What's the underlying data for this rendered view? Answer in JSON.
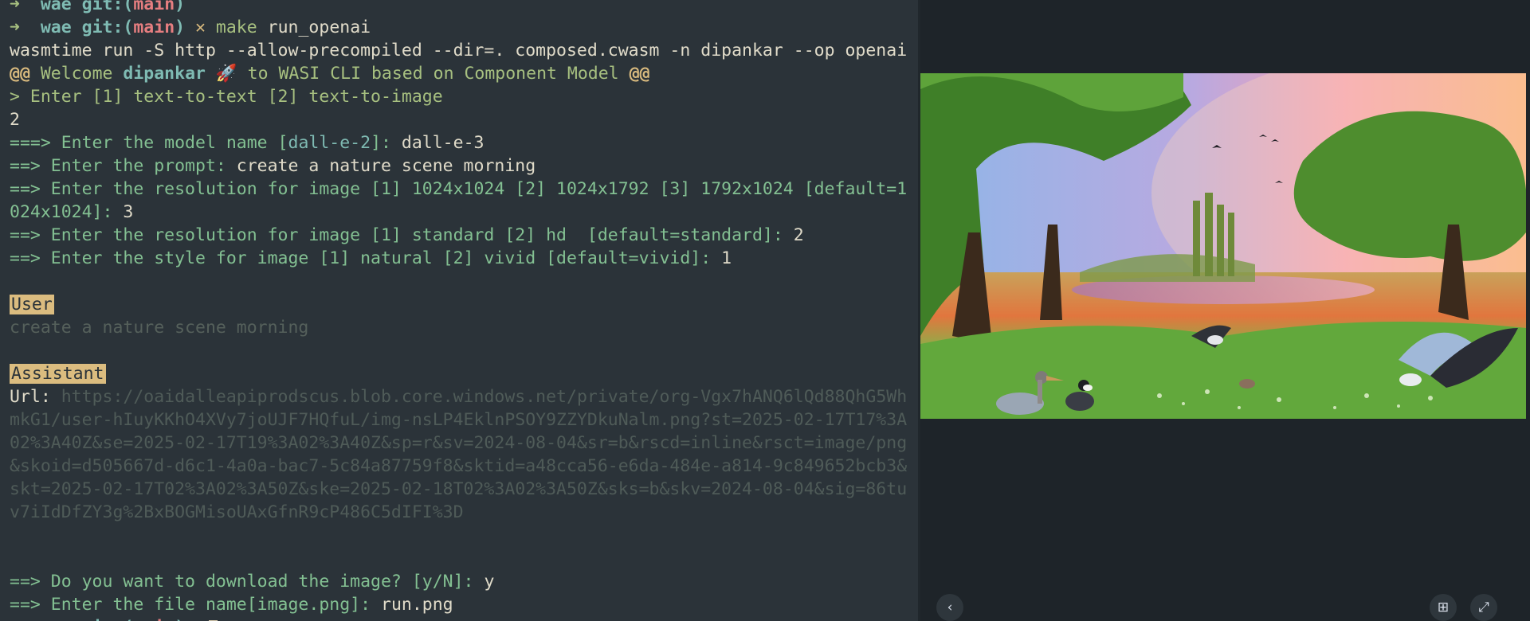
{
  "terminal": {
    "lines": [
      {
        "parts": [
          {
            "t": "➜  ",
            "c": "green bold"
          },
          {
            "t": "wae ",
            "c": "aqua bold"
          },
          {
            "t": "git:(",
            "c": "aqua bold"
          },
          {
            "t": "main",
            "c": "red bold"
          },
          {
            "t": ")",
            "c": "aqua bold"
          }
        ]
      },
      {
        "parts": [
          {
            "t": "➜  ",
            "c": "green bold"
          },
          {
            "t": "wae ",
            "c": "aqua bold"
          },
          {
            "t": "git:(",
            "c": "aqua bold"
          },
          {
            "t": "main",
            "c": "red bold"
          },
          {
            "t": ") ",
            "c": "aqua bold"
          },
          {
            "t": "✕ ",
            "c": "yellow bold"
          },
          {
            "t": "make ",
            "c": "green"
          },
          {
            "t": "run_openai",
            "c": "white"
          }
        ]
      },
      {
        "parts": [
          {
            "t": "wasmtime run -S http --allow-precompiled --dir=. composed.cwasm -n dipankar --op openai",
            "c": "white"
          }
        ]
      },
      {
        "parts": [
          {
            "t": "@@ ",
            "c": "yellow bold"
          },
          {
            "t": "Welcome ",
            "c": "green"
          },
          {
            "t": "dipankar",
            "c": "aqua bold"
          },
          {
            "t": " 🚀 ",
            "c": "white"
          },
          {
            "t": "to WASI CLI based on Component Model ",
            "c": "green"
          },
          {
            "t": "@@",
            "c": "yellow bold"
          }
        ]
      },
      {
        "parts": [
          {
            "t": "> Enter [1] text-to-text [2] text-to-image",
            "c": "green"
          }
        ]
      },
      {
        "parts": [
          {
            "t": "2",
            "c": "white"
          }
        ]
      },
      {
        "parts": [
          {
            "t": "===> Enter the model name [",
            "c": "cyan"
          },
          {
            "t": "dall-e-2",
            "c": "aqua"
          },
          {
            "t": "]: ",
            "c": "cyan"
          },
          {
            "t": "dall-e-3",
            "c": "white"
          }
        ]
      },
      {
        "parts": [
          {
            "t": "==> Enter the prompt: ",
            "c": "cyan"
          },
          {
            "t": "create a nature scene morning",
            "c": "white"
          }
        ]
      },
      {
        "parts": [
          {
            "t": "==> Enter the resolution for image [1] 1024x1024 [2] 1024x1792 [3] 1792x1024 [default=1",
            "c": "cyan"
          }
        ]
      },
      {
        "parts": [
          {
            "t": "024x1024]: ",
            "c": "cyan"
          },
          {
            "t": "3",
            "c": "white"
          }
        ]
      },
      {
        "parts": [
          {
            "t": "==> Enter the resolution for image [1] standard [2] hd  [default=standard]: ",
            "c": "cyan"
          },
          {
            "t": "2",
            "c": "white"
          }
        ]
      },
      {
        "parts": [
          {
            "t": "==> Enter the style for image [1] natural [2] vivid [default=vivid]: ",
            "c": "cyan"
          },
          {
            "t": "1",
            "c": "white"
          }
        ]
      },
      {
        "parts": []
      },
      {
        "parts": [
          {
            "t": "User",
            "c": "chip"
          }
        ]
      },
      {
        "parts": [
          {
            "t": "create a nature scene morning",
            "c": "dimmer"
          }
        ]
      },
      {
        "parts": []
      },
      {
        "parts": [
          {
            "t": "Assistant",
            "c": "chip"
          }
        ]
      },
      {
        "parts": [
          {
            "t": "Url: ",
            "c": "white"
          },
          {
            "t": "https://oaidalleapiprodscus.blob.core.windows.net/private/org-Vgx7hANQ6lQd88QhG5Wh",
            "c": "dim"
          }
        ]
      },
      {
        "parts": [
          {
            "t": "mkG1/user-hIuyKKhO4XVy7joUJF7HQfuL/img-nsLP4EklnPSOY9ZZYDkuNalm.png?st=2025-02-17T17%3A",
            "c": "dim"
          }
        ]
      },
      {
        "parts": [
          {
            "t": "02%3A40Z&se=2025-02-17T19%3A02%3A40Z&sp=r&sv=2024-08-04&sr=b&rscd=inline&rsct=image/png",
            "c": "dim"
          }
        ]
      },
      {
        "parts": [
          {
            "t": "&skoid=d505667d-d6c1-4a0a-bac7-5c84a87759f8&sktid=a48cca56-e6da-484e-a814-9c849652bcb3&",
            "c": "dim"
          }
        ]
      },
      {
        "parts": [
          {
            "t": "skt=2025-02-17T02%3A02%3A50Z&ske=2025-02-18T02%3A02%3A50Z&sks=b&skv=2024-08-04&sig=86tu",
            "c": "dim"
          }
        ]
      },
      {
        "parts": [
          {
            "t": "v7iIdDfZY3g%2BxBOGMisoUAxGfnR9cP486C5dIFI%3D",
            "c": "dim"
          }
        ]
      },
      {
        "parts": []
      },
      {
        "parts": []
      },
      {
        "parts": [
          {
            "t": "==> Do you want to download the image? [y/N]: ",
            "c": "cyan"
          },
          {
            "t": "y",
            "c": "white"
          }
        ]
      },
      {
        "parts": [
          {
            "t": "==> Enter the file name[image.png]: ",
            "c": "cyan"
          },
          {
            "t": "run.png",
            "c": "white"
          }
        ]
      },
      {
        "parts": [
          {
            "t": "➜  ",
            "c": "green bold"
          },
          {
            "t": "wae ",
            "c": "aqua bold"
          },
          {
            "t": "git:(",
            "c": "aqua bold"
          },
          {
            "t": "main",
            "c": "red bold"
          },
          {
            "t": ") ",
            "c": "aqua bold"
          },
          {
            "t": "✕",
            "c": "yellow bold"
          }
        ],
        "cursor": true
      }
    ]
  },
  "viewer": {
    "prev_icon": "chevron-left-icon",
    "add_icon": "plus-square-icon",
    "expand_icon": "expand-icon",
    "prev_glyph": "‹",
    "add_glyph": "⊞",
    "expand_glyph": "⤢"
  },
  "colors": {
    "terminal_bg": "#2b3339",
    "viewer_bg": "#1e2429",
    "chip_bg": "#dbbc7f"
  }
}
